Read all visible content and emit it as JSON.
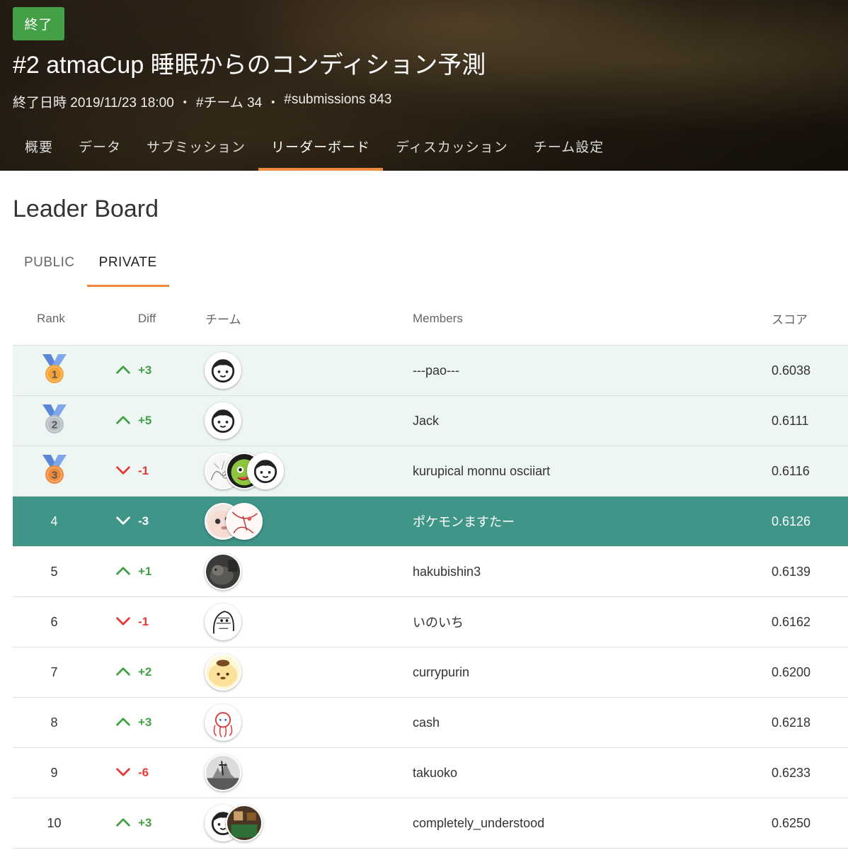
{
  "competition": {
    "status": "終了",
    "title": "#2 atmaCup 睡眠からのコンディション予測",
    "end_date": "終了日時 2019/11/23 18:00",
    "teams": "#チーム 34",
    "submissions": "#submissions 843",
    "separator": "・"
  },
  "nav": {
    "tabs": [
      "概要",
      "データ",
      "サブミッション",
      "リーダーボード",
      "ディスカッション",
      "チーム設定"
    ],
    "active": "リーダーボード"
  },
  "page_title": "Leader Board",
  "board_tabs": [
    "PUBLIC",
    "PRIVATE"
  ],
  "board_active": "PRIVATE",
  "columns": {
    "rank": "Rank",
    "diff": "Diff",
    "team": "チーム",
    "members": "Members",
    "score": "スコア"
  },
  "rows": [
    {
      "rank": "1",
      "medal": "gold",
      "diff": "+3",
      "direction": "up",
      "members": "---pao---",
      "score": "0.6038",
      "avatars": [
        "face"
      ]
    },
    {
      "rank": "2",
      "medal": "silver",
      "diff": "+5",
      "direction": "up",
      "members": "Jack",
      "score": "0.6111",
      "avatars": [
        "face"
      ]
    },
    {
      "rank": "3",
      "medal": "bronze",
      "diff": "-1",
      "direction": "down",
      "members": "kurupical monnu osciiart",
      "score": "0.6116",
      "avatars": [
        "sketch",
        "green-character",
        "face"
      ]
    },
    {
      "rank": "4",
      "medal": "",
      "diff": "-3",
      "direction": "down",
      "members": "ポケモンますたー",
      "score": "0.6126",
      "avatars": [
        "round-character",
        "drawing"
      ],
      "highlight": true
    },
    {
      "rank": "5",
      "medal": "",
      "diff": "+1",
      "direction": "up",
      "members": "hakubishin3",
      "score": "0.6139",
      "avatars": [
        "animal-photo"
      ]
    },
    {
      "rank": "6",
      "medal": "",
      "diff": "-1",
      "direction": "down",
      "members": "いのいち",
      "score": "0.6162",
      "avatars": [
        "manga"
      ]
    },
    {
      "rank": "7",
      "medal": "",
      "diff": "+2",
      "direction": "up",
      "members": "currypurin",
      "score": "0.6200",
      "avatars": [
        "pompompurin"
      ]
    },
    {
      "rank": "8",
      "medal": "",
      "diff": "+3",
      "direction": "up",
      "members": "cash",
      "score": "0.6218",
      "avatars": [
        "octopus-sketch"
      ]
    },
    {
      "rank": "9",
      "medal": "",
      "diff": "-6",
      "direction": "down",
      "members": "takuoko",
      "score": "0.6233",
      "avatars": [
        "bw-photo"
      ]
    },
    {
      "rank": "10",
      "medal": "",
      "diff": "+3",
      "direction": "up",
      "members": "completely_understood",
      "score": "0.6250",
      "avatars": [
        "face",
        "room-photo"
      ]
    }
  ],
  "colors": {
    "accent": "#ef8a3c",
    "status_green": "#43a047",
    "up": "#43a047",
    "down": "#e53935",
    "highlight_row": "#3f9587",
    "medal_row": "#eef6f4"
  }
}
